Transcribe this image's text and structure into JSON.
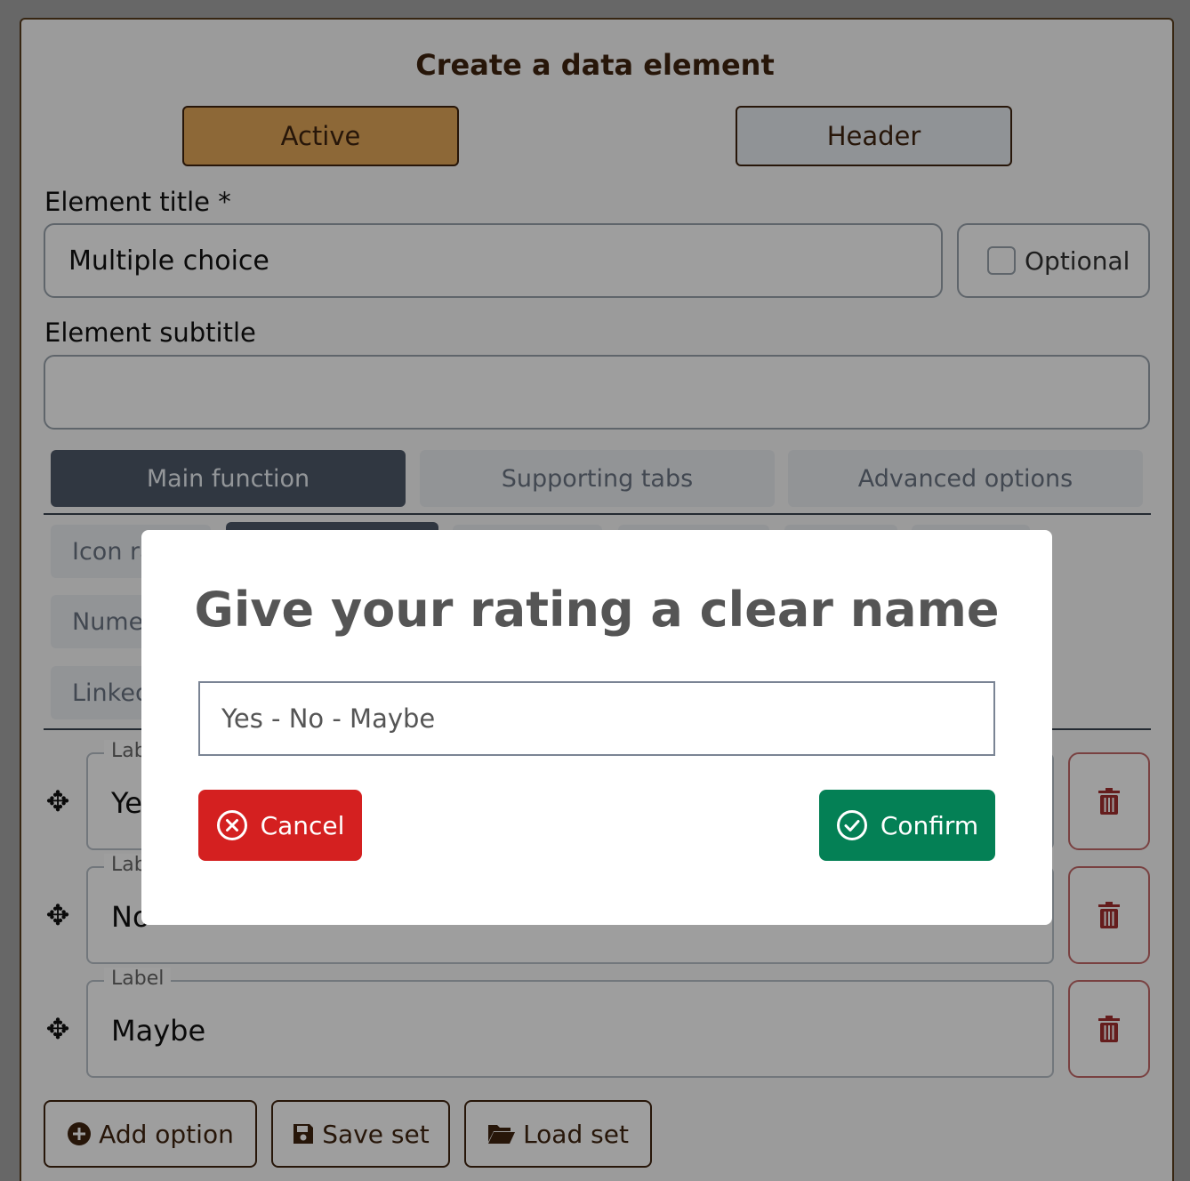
{
  "page": {
    "title": "Create a data element",
    "mode_buttons": {
      "active": "Active",
      "header": "Header"
    }
  },
  "form": {
    "element_title_label": "Element title *",
    "element_title_value": "Multiple choice",
    "optional_label": "Optional",
    "optional_checked": false,
    "element_subtitle_label": "Element subtitle",
    "element_subtitle_value": ""
  },
  "tabs": [
    {
      "label": "Main function",
      "selected": true
    },
    {
      "label": "Supporting tabs",
      "selected": false
    },
    {
      "label": "Advanced options",
      "selected": false
    }
  ],
  "sub_tabs": [
    "Icon ra",
    "Numer",
    "Linked"
  ],
  "options": [
    {
      "legend": "Lab",
      "value": "Ye"
    },
    {
      "legend": "Lab",
      "value": "No"
    },
    {
      "legend": "Label",
      "value": "Maybe"
    }
  ],
  "actions": {
    "add_option": "Add option",
    "save_set": "Save set",
    "load_set": "Load set"
  },
  "modal": {
    "title": "Give your rating a clear name",
    "input_value": "Yes - No - Maybe",
    "cancel_label": "Cancel",
    "confirm_label": "Confirm"
  },
  "colors": {
    "brown": "#3f2410",
    "active_gold": "#e4a85a",
    "tab_dark": "#4e5a6a",
    "cancel_red": "#d42020",
    "confirm_green": "#048055",
    "delete_red": "#a33030"
  },
  "icons": {
    "drag": "four-way-arrow-icon",
    "delete": "trash-icon",
    "add": "plus-circle-icon",
    "save": "floppy-disk-icon",
    "load": "folder-open-icon",
    "cancel": "x-circle-icon",
    "confirm": "check-circle-icon"
  }
}
